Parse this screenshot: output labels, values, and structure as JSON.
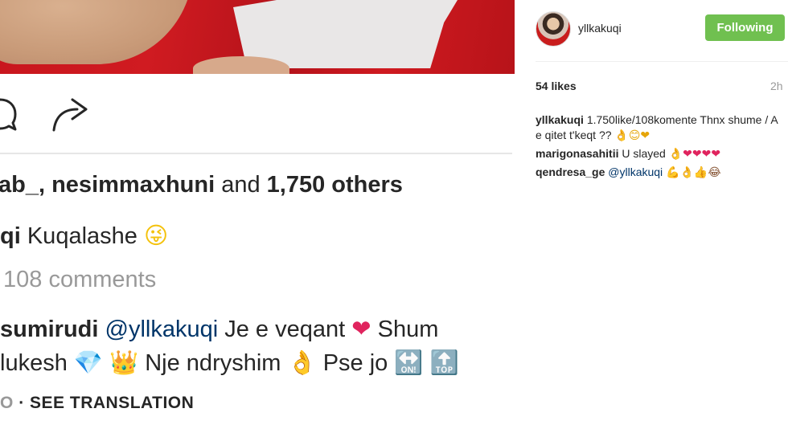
{
  "post": {
    "likers_partial": "ab_,",
    "liker_named": "nesimmaxhuni",
    "and_text": "and",
    "others_count": "1,750 others",
    "caption_user_partial": "qi",
    "caption_text": "Kuqalashe",
    "caption_emoji": "😜",
    "view_comments": "108 comments",
    "comment_user_partial": "sumirudi",
    "comment_mention": "@yllkakuqi",
    "comment_text1": "Je e veqant",
    "comment_heart": "❤",
    "comment_text1b": "Shum",
    "comment_text2a": "lukesh",
    "comment_gem": "💎",
    "comment_crown": "👑",
    "comment_text2b": "Nje ndryshim",
    "comment_ok": "👌",
    "comment_text2c": "Pse jo",
    "comment_on_emoji": "🔛",
    "comment_top_emoji": "🔝",
    "translation_prefix": "O",
    "see_translation": "· SEE TRANSLATION"
  },
  "sidebar": {
    "username": "yllkakuqi",
    "follow_button": "Following",
    "likes": "54 likes",
    "time": "2h",
    "comments": [
      {
        "user": "yllkakuqi",
        "text": "1.750like/108komente Thnx shume / A e qitet t'keqt ??",
        "emoji": "👌😊❤"
      },
      {
        "user": "marigonasahitii",
        "text": "U slayed",
        "emoji": "👌❤❤❤❤"
      },
      {
        "user": "qendresa_ge",
        "mention": "@yllkakuqi",
        "emoji": "💪👌👍😂"
      }
    ]
  },
  "icons": {
    "comment": "comment-icon",
    "share": "share-icon"
  },
  "colors": {
    "following_button_bg": "#70c050",
    "mention": "#003569",
    "muted_text": "#999999"
  }
}
